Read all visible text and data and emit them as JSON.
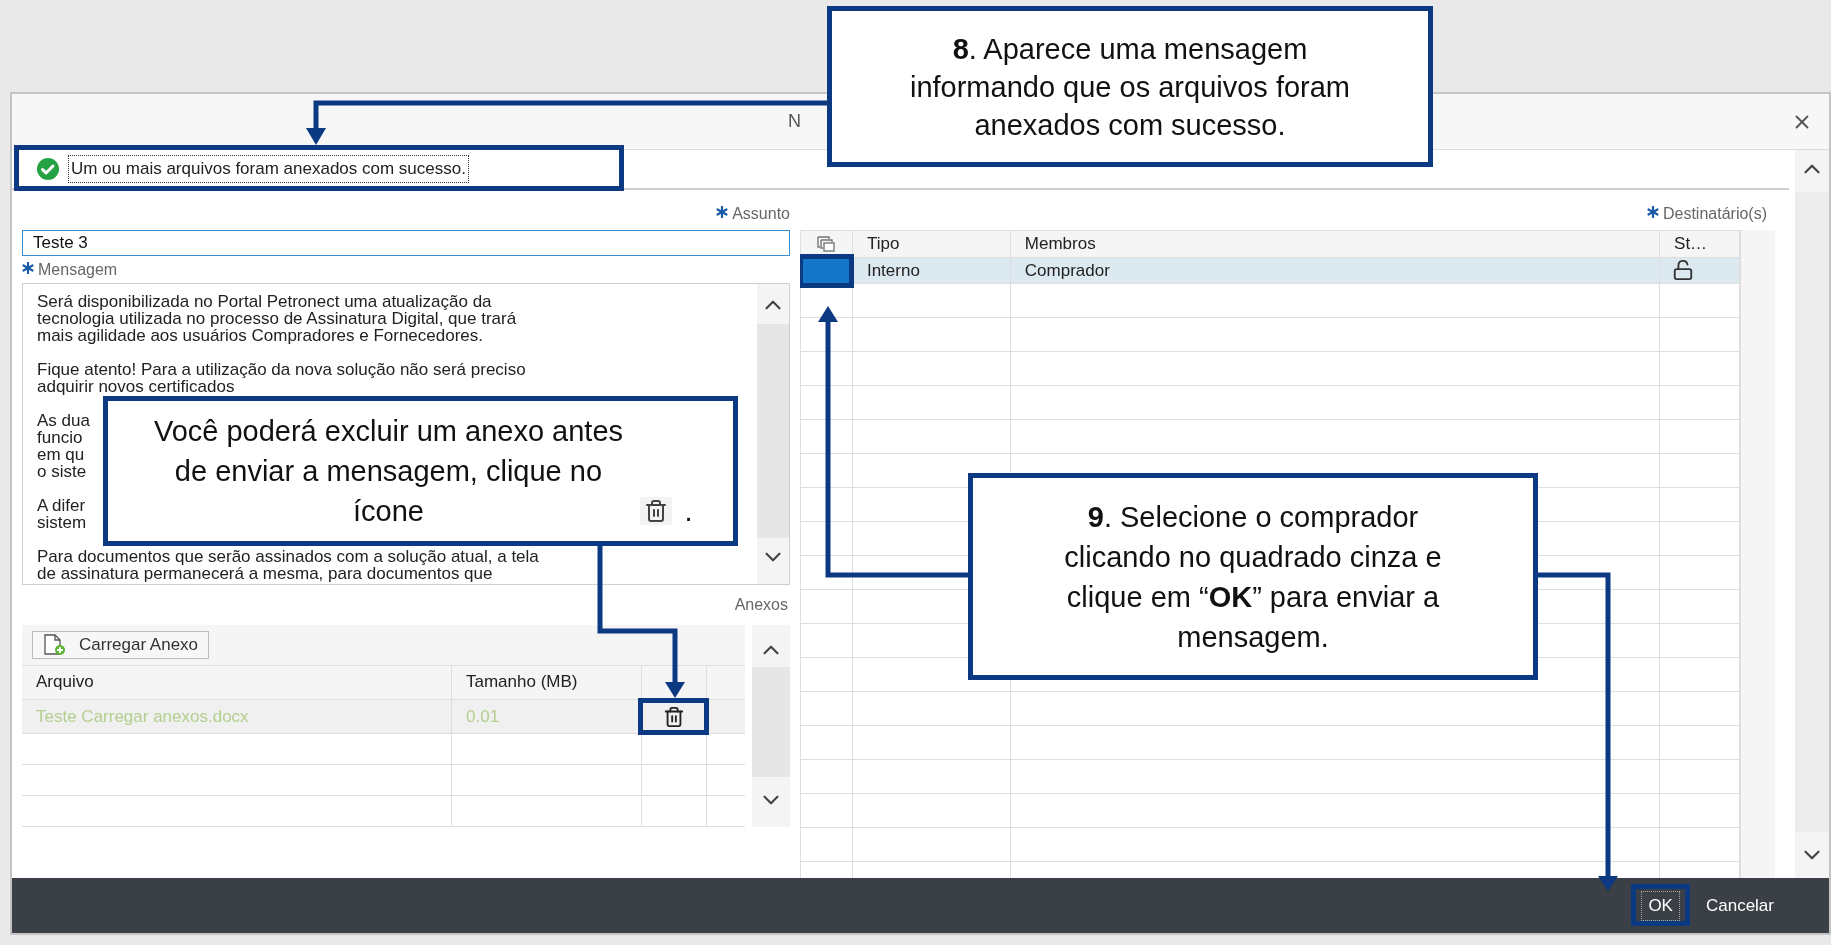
{
  "window": {
    "title": "N"
  },
  "message_bar": {
    "text": "Um ou mais arquivos foram anexados com sucesso."
  },
  "subject": {
    "label": "Assunto",
    "required": true,
    "value": "Teste 3"
  },
  "message": {
    "label": "Mensagem",
    "required": true,
    "paragraphs": [
      [
        "Será disponibilizada no Portal Petronect uma atualização da",
        "tecnologia utilizada no processo de Assinatura Digital, que trará",
        "mais agilidade aos usuários Compradores e Fornecedores."
      ],
      [
        "Fique atento! Para a utilização da nova solução não será preciso",
        "adquirir novos certificados"
      ],
      [
        "As dua",
        "funcio",
        "em qu",
        "o siste"
      ],
      [
        "A difer",
        "sistem"
      ],
      [
        "Para documentos que serão assinados com a solução atual, a tela",
        "de assinatura permanecerá a mesma, para documentos que"
      ]
    ]
  },
  "attachments": {
    "label": "Anexos",
    "upload_button": "Carregar Anexo",
    "columns": [
      "Arquivo",
      "Tamanho (MB)"
    ],
    "rows": [
      {
        "file": "Teste Carregar anexos.docx",
        "size": "0.01"
      }
    ]
  },
  "recipients": {
    "label": "Destinatário(s)",
    "required": true,
    "columns": [
      "Tipo",
      "Membros",
      "St…"
    ],
    "rows": [
      {
        "type": "Interno",
        "member": "Comprador",
        "selected": true
      }
    ]
  },
  "footer": {
    "buttons": [
      "OK",
      "Cancelar"
    ]
  },
  "callouts": {
    "attachment_notice": "**8**. Aparece uma mensagem informando que os arquivos foram anexados com sucesso.",
    "delete_tip": {
      "text": "Você poderá excluir um anexo antes de enviar a mensagem, clique no ícone",
      "suffix": "."
    },
    "select_tip": "**9**. Selecione o comprador clicando no quadrado cinza e clique em “**OK**” para enviar a mensagem."
  }
}
